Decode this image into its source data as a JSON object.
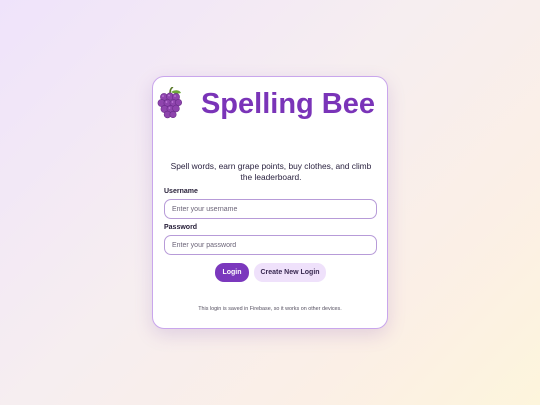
{
  "app": {
    "title": "Spelling Bee",
    "icon": "grape-icon",
    "subtitle": "Spell words, earn grape points, buy clothes, and climb the leaderboard."
  },
  "form": {
    "username_label": "Username",
    "username_placeholder": "Enter your username",
    "username_value": "",
    "password_label": "Password",
    "password_placeholder": "Enter your password",
    "password_value": ""
  },
  "actions": {
    "login_label": "Login",
    "create_label": "Create New Login"
  },
  "footer": {
    "note": "This login is saved in Firebase, so it works on other devices."
  },
  "colors": {
    "accent": "#7a34b8",
    "button_primary": "#7b38bd",
    "button_secondary": "#efe1fb",
    "card_border": "#c9a6ec"
  }
}
